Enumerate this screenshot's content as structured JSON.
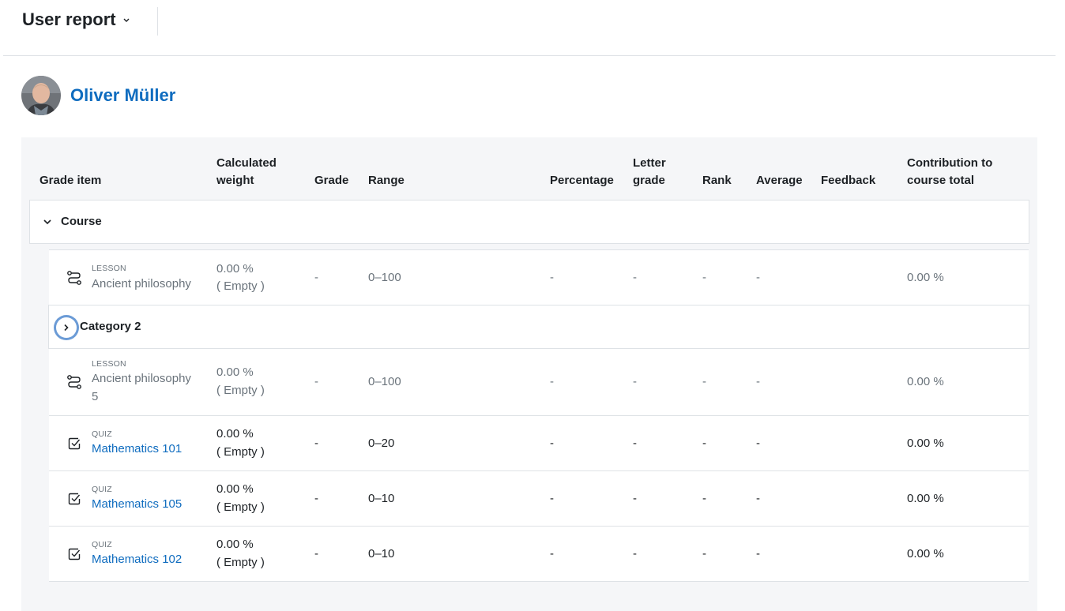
{
  "header": {
    "title": "User report"
  },
  "user": {
    "name": "Oliver Müller"
  },
  "table": {
    "columns": {
      "grade_item": "Grade item",
      "weight_1": "Calculated",
      "weight_2": "weight",
      "grade": "Grade",
      "range": "Range",
      "percentage": "Percentage",
      "letter_1": "Letter",
      "letter_2": "grade",
      "rank": "Rank",
      "average": "Average",
      "feedback": "Feedback",
      "contribution_1": "Contribution to",
      "contribution_2": "course total"
    },
    "course_label": "Course",
    "category_label": "Category 2",
    "rows": [
      {
        "type": "LESSON",
        "name": "Ancient philosophy",
        "weight": "0.00 %",
        "weight_note": "( Empty )",
        "grade": "-",
        "range": "0–100",
        "percentage": "-",
        "letter": "-",
        "rank": "-",
        "average": "-",
        "contribution": "0.00 %"
      },
      {
        "type": "LESSON",
        "name_1": "Ancient philosophy",
        "name_2": "5",
        "weight": "0.00 %",
        "weight_note": "( Empty )",
        "grade": "-",
        "range": "0–100",
        "percentage": "-",
        "letter": "-",
        "rank": "-",
        "average": "-",
        "contribution": "0.00 %"
      },
      {
        "type": "QUIZ",
        "name": "Mathematics 101",
        "weight": "0.00 %",
        "weight_note": "( Empty )",
        "grade": "-",
        "range": "0–20",
        "percentage": "-",
        "letter": "-",
        "rank": "-",
        "average": "-",
        "contribution": "0.00 %"
      },
      {
        "type": "QUIZ",
        "name": "Mathematics 105",
        "weight": "0.00 %",
        "weight_note": "( Empty )",
        "grade": "-",
        "range": "0–10",
        "percentage": "-",
        "letter": "-",
        "rank": "-",
        "average": "-",
        "contribution": "0.00 %"
      },
      {
        "type": "QUIZ",
        "name": "Mathematics 102",
        "weight": "0.00 %",
        "weight_note": "( Empty )",
        "grade": "-",
        "range": "0–10",
        "percentage": "-",
        "letter": "-",
        "rank": "-",
        "average": "-",
        "contribution": "0.00 %"
      }
    ]
  },
  "icons": {
    "lesson": "lesson-path-icon",
    "quiz": "quiz-checkbox-icon",
    "collapse": "chevron-down-icon",
    "expand": "chevron-right-icon"
  },
  "colors": {
    "link": "#0f6cbf",
    "muted": "#6a737b",
    "panel": "#f5f6f8",
    "border": "#dee2e6"
  }
}
